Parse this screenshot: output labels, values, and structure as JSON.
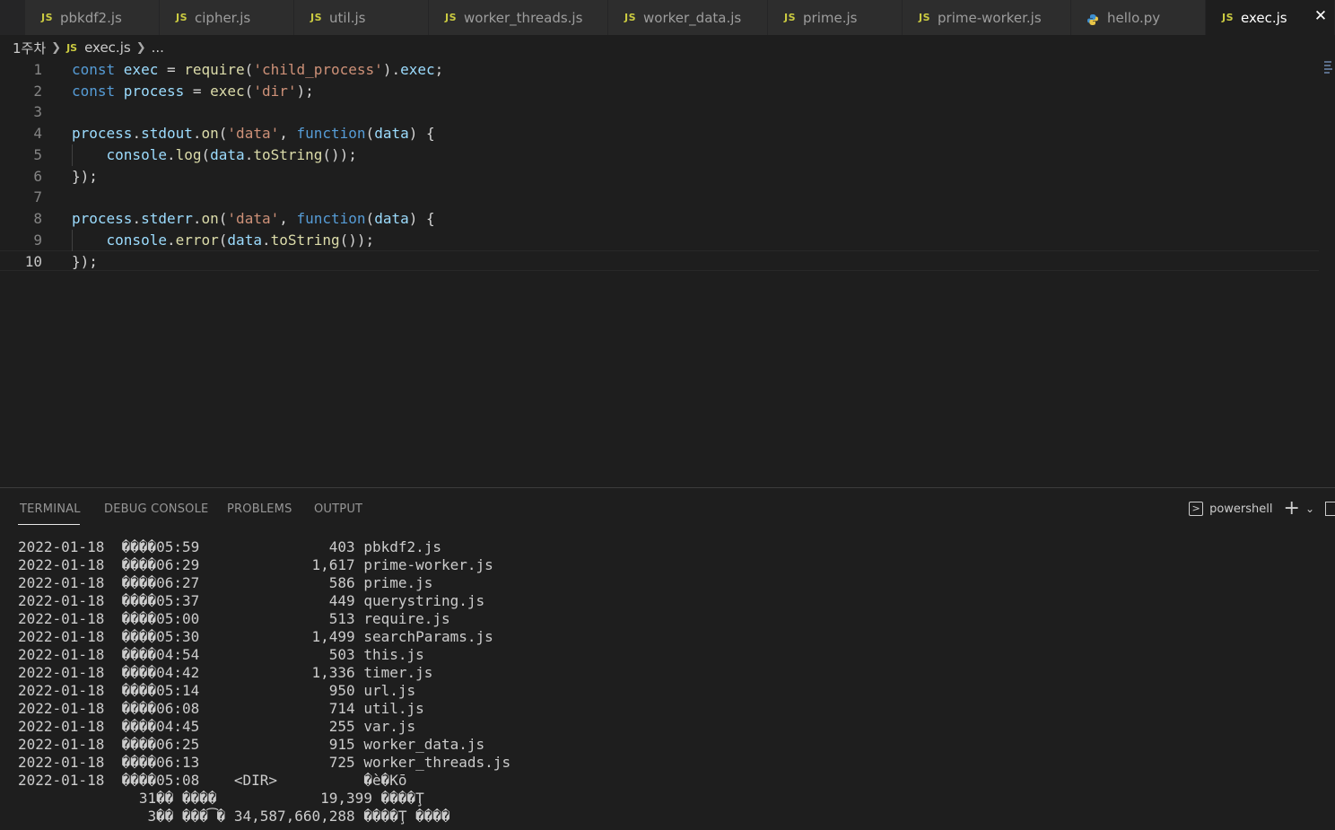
{
  "tabs": [
    {
      "label": "pbkdf2.js",
      "icon": "js"
    },
    {
      "label": "cipher.js",
      "icon": "js"
    },
    {
      "label": "util.js",
      "icon": "js"
    },
    {
      "label": "worker_threads.js",
      "icon": "js"
    },
    {
      "label": "worker_data.js",
      "icon": "js"
    },
    {
      "label": "prime.js",
      "icon": "js"
    },
    {
      "label": "prime-worker.js",
      "icon": "js"
    },
    {
      "label": "hello.py",
      "icon": "python"
    },
    {
      "label": "exec.js",
      "icon": "js",
      "active": true
    }
  ],
  "js_icon_text": "JS",
  "close_glyph": "✕",
  "breadcrumb": {
    "folder": "1주차",
    "file": "exec.js",
    "more": "..."
  },
  "editor": {
    "current_line": 10,
    "line_numbers": [
      "1",
      "2",
      "3",
      "4",
      "5",
      "6",
      "7",
      "8",
      "9",
      "10"
    ],
    "lines": [
      [
        [
          "k",
          "const "
        ],
        [
          "v",
          "exec"
        ],
        [
          "p",
          " = "
        ],
        [
          "f",
          "require"
        ],
        [
          "p",
          "("
        ],
        [
          "s",
          "'child_process'"
        ],
        [
          "p",
          ")."
        ],
        [
          "v",
          "exec"
        ],
        [
          "p",
          ";"
        ]
      ],
      [
        [
          "k",
          "const "
        ],
        [
          "v",
          "process"
        ],
        [
          "p",
          " = "
        ],
        [
          "f",
          "exec"
        ],
        [
          "p",
          "("
        ],
        [
          "s",
          "'dir'"
        ],
        [
          "p",
          ");"
        ]
      ],
      [],
      [
        [
          "v",
          "process"
        ],
        [
          "p",
          "."
        ],
        [
          "v",
          "stdout"
        ],
        [
          "p",
          "."
        ],
        [
          "f",
          "on"
        ],
        [
          "p",
          "("
        ],
        [
          "s",
          "'data'"
        ],
        [
          "p",
          ", "
        ],
        [
          "k",
          "function"
        ],
        [
          "p",
          "("
        ],
        [
          "v",
          "data"
        ],
        [
          "p",
          ") {"
        ]
      ],
      [
        [
          "p",
          "    "
        ],
        [
          "v",
          "console"
        ],
        [
          "p",
          "."
        ],
        [
          "f",
          "log"
        ],
        [
          "p",
          "("
        ],
        [
          "v",
          "data"
        ],
        [
          "p",
          "."
        ],
        [
          "f",
          "toString"
        ],
        [
          "p",
          "());"
        ]
      ],
      [
        [
          "p",
          "});"
        ]
      ],
      [],
      [
        [
          "v",
          "process"
        ],
        [
          "p",
          "."
        ],
        [
          "v",
          "stderr"
        ],
        [
          "p",
          "."
        ],
        [
          "f",
          "on"
        ],
        [
          "p",
          "("
        ],
        [
          "s",
          "'data'"
        ],
        [
          "p",
          ", "
        ],
        [
          "k",
          "function"
        ],
        [
          "p",
          "("
        ],
        [
          "v",
          "data"
        ],
        [
          "p",
          ") {"
        ]
      ],
      [
        [
          "p",
          "    "
        ],
        [
          "v",
          "console"
        ],
        [
          "p",
          "."
        ],
        [
          "f",
          "error"
        ],
        [
          "p",
          "("
        ],
        [
          "v",
          "data"
        ],
        [
          "p",
          "."
        ],
        [
          "f",
          "toString"
        ],
        [
          "p",
          "());"
        ]
      ],
      [
        [
          "p",
          "});"
        ]
      ]
    ]
  },
  "panel": {
    "tabs": [
      "TERMINAL",
      "DEBUG CONSOLE",
      "PROBLEMS",
      "OUTPUT"
    ],
    "active_tab": "TERMINAL",
    "shell": "powershell",
    "terminal_lines": [
      "2022-01-18  ����05:59               403 pbkdf2.js",
      "2022-01-18  ����06:29             1,617 prime-worker.js",
      "2022-01-18  ����06:27               586 prime.js",
      "2022-01-18  ����05:37               449 querystring.js",
      "2022-01-18  ����05:00               513 require.js",
      "2022-01-18  ����05:30             1,499 searchParams.js",
      "2022-01-18  ����04:54               503 this.js",
      "2022-01-18  ����04:42             1,336 timer.js",
      "2022-01-18  ����05:14               950 url.js",
      "2022-01-18  ����06:08               714 util.js",
      "2022-01-18  ����04:45               255 var.js",
      "2022-01-18  ����06:25               915 worker_data.js",
      "2022-01-18  ����06:13               725 worker_threads.js",
      "2022-01-18  ����05:08    <DIR>          �è�Kō",
      "              31�� ����            19,399 ����Ţ",
      "               3�� ���͡� 34,587,660,288 ����Ţ ����"
    ]
  }
}
